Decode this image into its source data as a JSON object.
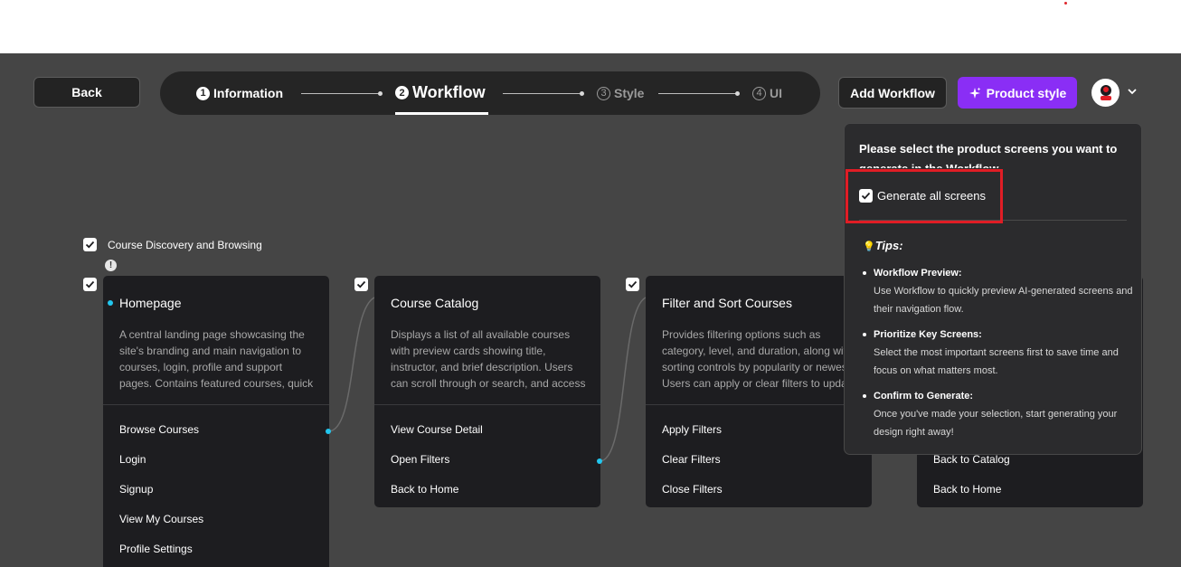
{
  "header": {
    "back_label": "Back",
    "steps": [
      {
        "num": "1",
        "label": "Information"
      },
      {
        "num": "2",
        "label": "Workflow"
      },
      {
        "num": "3",
        "label": "Style"
      },
      {
        "num": "4",
        "label": "UI"
      }
    ],
    "active_step": 2,
    "add_workflow_label": "Add Workflow",
    "product_style_label": "Product style"
  },
  "group": {
    "label": "Course Discovery and Browsing"
  },
  "cards": [
    {
      "title": "Homepage",
      "desc": [
        "A central landing page showcasing the",
        "site's branding and main navigation to",
        "courses, login, profile and support",
        "pages. Contains featured courses, quick"
      ],
      "actions": [
        "Browse Courses",
        "Login",
        "Signup",
        "View My Courses",
        "Profile Settings"
      ]
    },
    {
      "title": "Course Catalog",
      "desc": [
        "Displays a list of all available courses",
        "with preview cards showing title,",
        "instructor, and brief description. Users",
        "can scroll through or search, and access"
      ],
      "actions": [
        "View Course Detail",
        "Open Filters",
        "Back to Home"
      ]
    },
    {
      "title": "Filter and Sort Courses",
      "desc": [
        "Provides filtering options such as",
        "category, level, and duration, along with",
        "sorting controls by popularity or newest.",
        "Users can apply or clear filters to update"
      ],
      "actions": [
        "Apply Filters",
        "Clear Filters",
        "Close Filters"
      ]
    },
    {
      "title": "",
      "desc": [],
      "actions": [
        "Back to Catalog",
        "Back to Home"
      ]
    }
  ],
  "popup": {
    "heading": "Please select the product screens you want to generate in the Workflow.",
    "generate_all_label": "Generate all screens",
    "generate_all_checked": true,
    "tips_icon": "💡",
    "tips_title": "Tips:",
    "tips": [
      {
        "title": "Workflow Preview:",
        "body": "Use Workflow to quickly preview AI-generated screens and their navigation flow."
      },
      {
        "title": "Prioritize Key Screens:",
        "body": "Select the most important screens first to save time and focus on what matters most."
      },
      {
        "title": "Confirm to Generate:",
        "body": "Once you've made your selection, start generating your design right away!"
      }
    ]
  },
  "colors": {
    "canvas": "#454545",
    "card": "#1d1d20",
    "accent_purple": "#8a2ef5",
    "connector_dot": "#22c6ee",
    "highlight": "#e01d25"
  }
}
